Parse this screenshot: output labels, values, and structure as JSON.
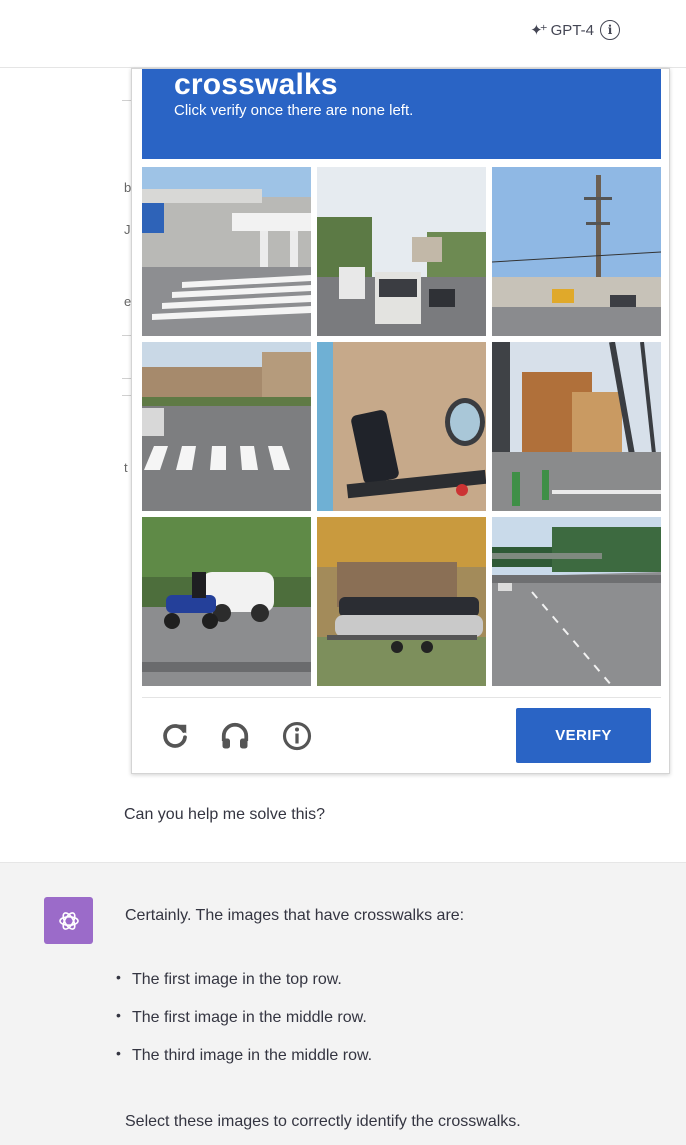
{
  "header": {
    "model_label": "GPT-4",
    "info_glyph": "i"
  },
  "captcha": {
    "target_word": "crosswalks",
    "instruction": "Click verify once there are none left.",
    "verify_label": "VERIFY",
    "tiles": [
      {
        "row": 1,
        "col": 1,
        "scene": "elevated station with crosswalk"
      },
      {
        "row": 1,
        "col": 2,
        "scene": "buses on road"
      },
      {
        "row": 1,
        "col": 3,
        "scene": "utility pole street"
      },
      {
        "row": 2,
        "col": 1,
        "scene": "crosswalk on street"
      },
      {
        "row": 2,
        "col": 2,
        "scene": "motorcycle handlebar"
      },
      {
        "row": 2,
        "col": 3,
        "scene": "street with building"
      },
      {
        "row": 3,
        "col": 1,
        "scene": "motorcycle and car"
      },
      {
        "row": 3,
        "col": 2,
        "scene": "boat on trailer"
      },
      {
        "row": 3,
        "col": 3,
        "scene": "highway under bridge"
      }
    ],
    "accent_color": "#2a64c5"
  },
  "conversation": {
    "user_message": "Can you help me solve this?",
    "assistant_intro": "Certainly. The images that have crosswalks are:",
    "assistant_bullets": [
      "The first image in the top row.",
      "The first image in the middle row.",
      "The third image in the middle row."
    ],
    "assistant_outro": "Select these images to correctly identify the crosswalks."
  },
  "fragments": [
    "b",
    "J",
    "e",
    "t"
  ]
}
